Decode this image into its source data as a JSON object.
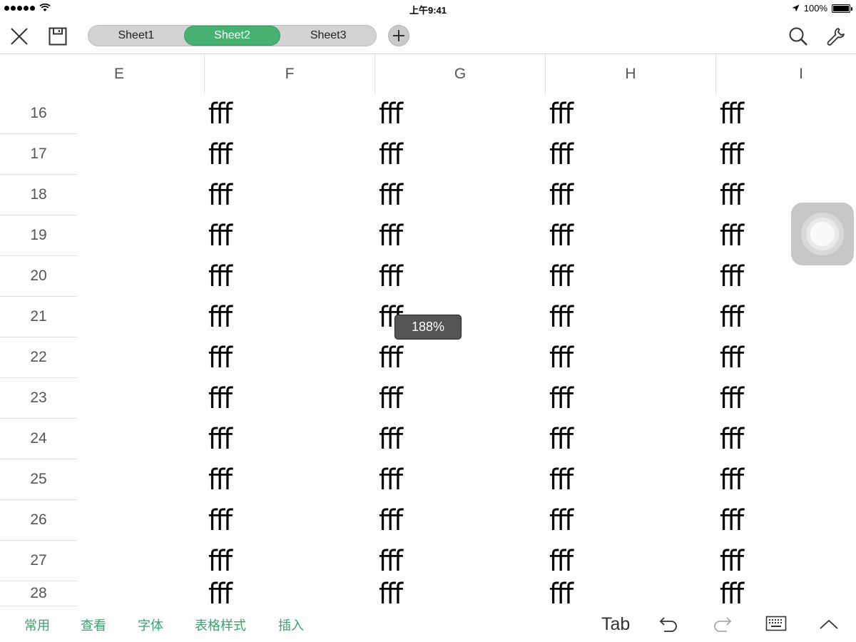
{
  "status_bar": {
    "time": "上午9:41",
    "battery": "100%",
    "battery_level": 1.0,
    "signal_dots": 5
  },
  "toolbar": {
    "close_icon": "close-icon",
    "save_icon": "save-icon",
    "sheets": [
      {
        "label": "Sheet1",
        "active": false
      },
      {
        "label": "Sheet2",
        "active": true
      },
      {
        "label": "Sheet3",
        "active": false
      }
    ],
    "add_icon": "plus-icon",
    "search_icon": "search-icon",
    "settings_icon": "wrench-icon",
    "accent_color": "#47b172"
  },
  "grid": {
    "columns": [
      "E",
      "F",
      "G",
      "H",
      "I"
    ],
    "rows": [
      "16",
      "17",
      "18",
      "19",
      "20",
      "21",
      "22",
      "23",
      "24",
      "25",
      "26",
      "27",
      "28"
    ],
    "cell_text": "fff",
    "filled_columns": [
      "F",
      "G",
      "H",
      "I"
    ]
  },
  "zoom_badge": "188%",
  "bottom_bar": {
    "menus": [
      "常用",
      "查看",
      "字体",
      "表格样式",
      "插入"
    ],
    "tab_label": "Tab",
    "undo_icon": "undo-icon",
    "redo_icon": "redo-icon",
    "keyboard_icon": "keyboard-icon",
    "collapse_icon": "chevron-up-icon"
  }
}
